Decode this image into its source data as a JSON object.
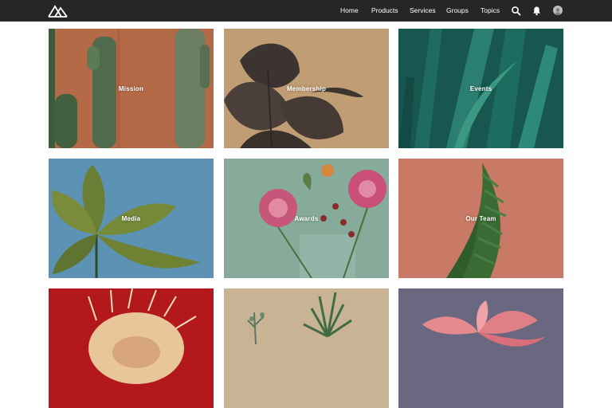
{
  "nav": {
    "logo_icon": "mountain-logo-icon",
    "items": [
      {
        "label": "Home"
      },
      {
        "label": "Products"
      },
      {
        "label": "Services"
      },
      {
        "label": "Groups"
      },
      {
        "label": "Topics"
      }
    ],
    "search_icon": "search-icon",
    "notifications_icon": "bell-icon",
    "avatar_icon": "user-avatar-icon"
  },
  "tiles": [
    {
      "label": "Mission",
      "bg": "#b56a47"
    },
    {
      "label": "Membership",
      "bg": "#c19d74"
    },
    {
      "label": "Events",
      "bg": "#17574f"
    },
    {
      "label": "Media",
      "bg": "#5c93b4"
    },
    {
      "label": "Awards",
      "bg": "#86ab9a"
    },
    {
      "label": "Our Team",
      "bg": "#c97a66"
    },
    {
      "label": "",
      "bg": "#b3191c"
    },
    {
      "label": "",
      "bg": "#c8b394"
    },
    {
      "label": "",
      "bg": "#6a6880"
    }
  ],
  "colors": {
    "topbar": "#262626",
    "page_bg": "#ffffff",
    "label_text": "#ffffff"
  }
}
